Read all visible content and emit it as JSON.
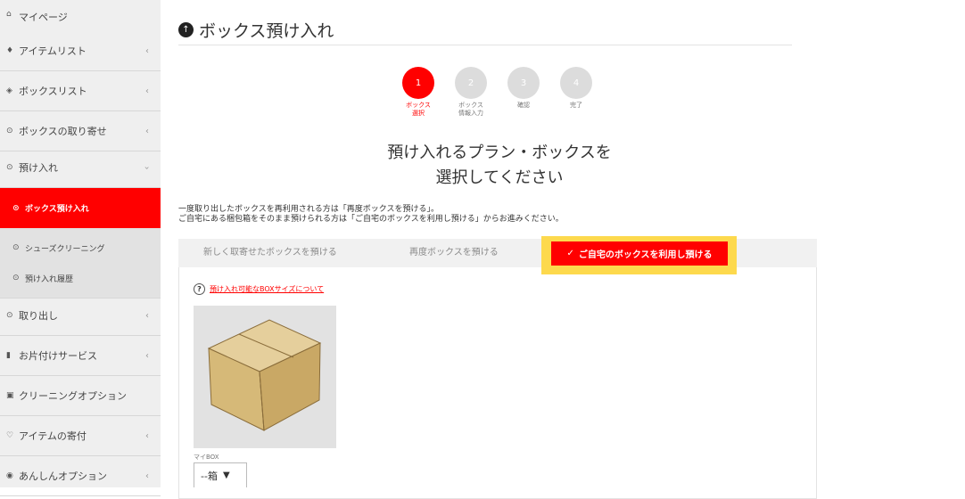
{
  "sidebar": {
    "items": [
      {
        "icon": "home-icon",
        "glyph": "⌂",
        "label": "マイページ"
      },
      {
        "icon": "diamond-icon",
        "glyph": "♦",
        "label": "アイテムリスト",
        "chev": "‹"
      },
      {
        "icon": "box-icon",
        "glyph": "◈",
        "label": "ボックスリスト",
        "chev": "‹"
      },
      {
        "icon": "circle-arrow-icon",
        "glyph": "⊙",
        "label": "ボックスの取り寄せ",
        "chev": "‹"
      },
      {
        "icon": "circle-arrow-icon",
        "glyph": "⊙",
        "label": "預け入れ",
        "chev": "‹"
      },
      {
        "icon": "circle-arrow-icon",
        "glyph": "⊙",
        "label": "ボックス預け入れ"
      },
      {
        "icon": "circle-arrow-icon",
        "glyph": "⊙",
        "label": "シューズクリーニング"
      },
      {
        "icon": "circle-arrow-icon",
        "glyph": "⊙",
        "label": "預け入れ履歴"
      },
      {
        "icon": "circle-arrow-icon",
        "glyph": "⊙",
        "label": "取り出し",
        "chev": "‹"
      },
      {
        "icon": "trash-icon",
        "glyph": "▮",
        "label": "お片付けサービス",
        "chev": "‹"
      },
      {
        "icon": "calendar-icon",
        "glyph": "▣",
        "label": "クリーニングオプション"
      },
      {
        "icon": "heart-icon",
        "glyph": "♡",
        "label": "アイテムの寄付",
        "chev": "‹"
      },
      {
        "icon": "shield-icon",
        "glyph": "◉",
        "label": "あんしんオプション",
        "chev": "‹"
      }
    ]
  },
  "page": {
    "title_glyph": "↑",
    "title": "ボックス預け入れ"
  },
  "steps": [
    {
      "num": "1",
      "label_line1": "ボックス",
      "label_line2": "選択"
    },
    {
      "num": "2",
      "label_line1": "ボックス",
      "label_line2": "情報入力"
    },
    {
      "num": "3",
      "label_line1": "確認",
      "label_line2": ""
    },
    {
      "num": "4",
      "label_line1": "完了",
      "label_line2": ""
    }
  ],
  "heading": {
    "line1": "預け入れるプラン・ボックスを",
    "line2": "選択してください"
  },
  "note": {
    "line1": "一度取り出したボックスを再利用される方は「再度ボックスを預ける」。",
    "line2": "ご自宅にある梱包箱をそのまま預けられる方は「ご自宅のボックスを利用し預ける」からお進みください。"
  },
  "tabs": {
    "new": "新しく取寄せたボックスを預ける",
    "again": "再度ボックスを預ける",
    "home": "ご自宅のボックスを利用し預ける",
    "check": "✓"
  },
  "panel": {
    "help_glyph": "?",
    "help_link": "預け入れ可能なBOXサイズについて",
    "box_name": "マイBOX",
    "qty_value": "--箱",
    "qty_arrow": "▼"
  },
  "colors": {
    "accent": "#ff0000",
    "highlight": "#fdd94d",
    "box": "#d7bc82"
  }
}
